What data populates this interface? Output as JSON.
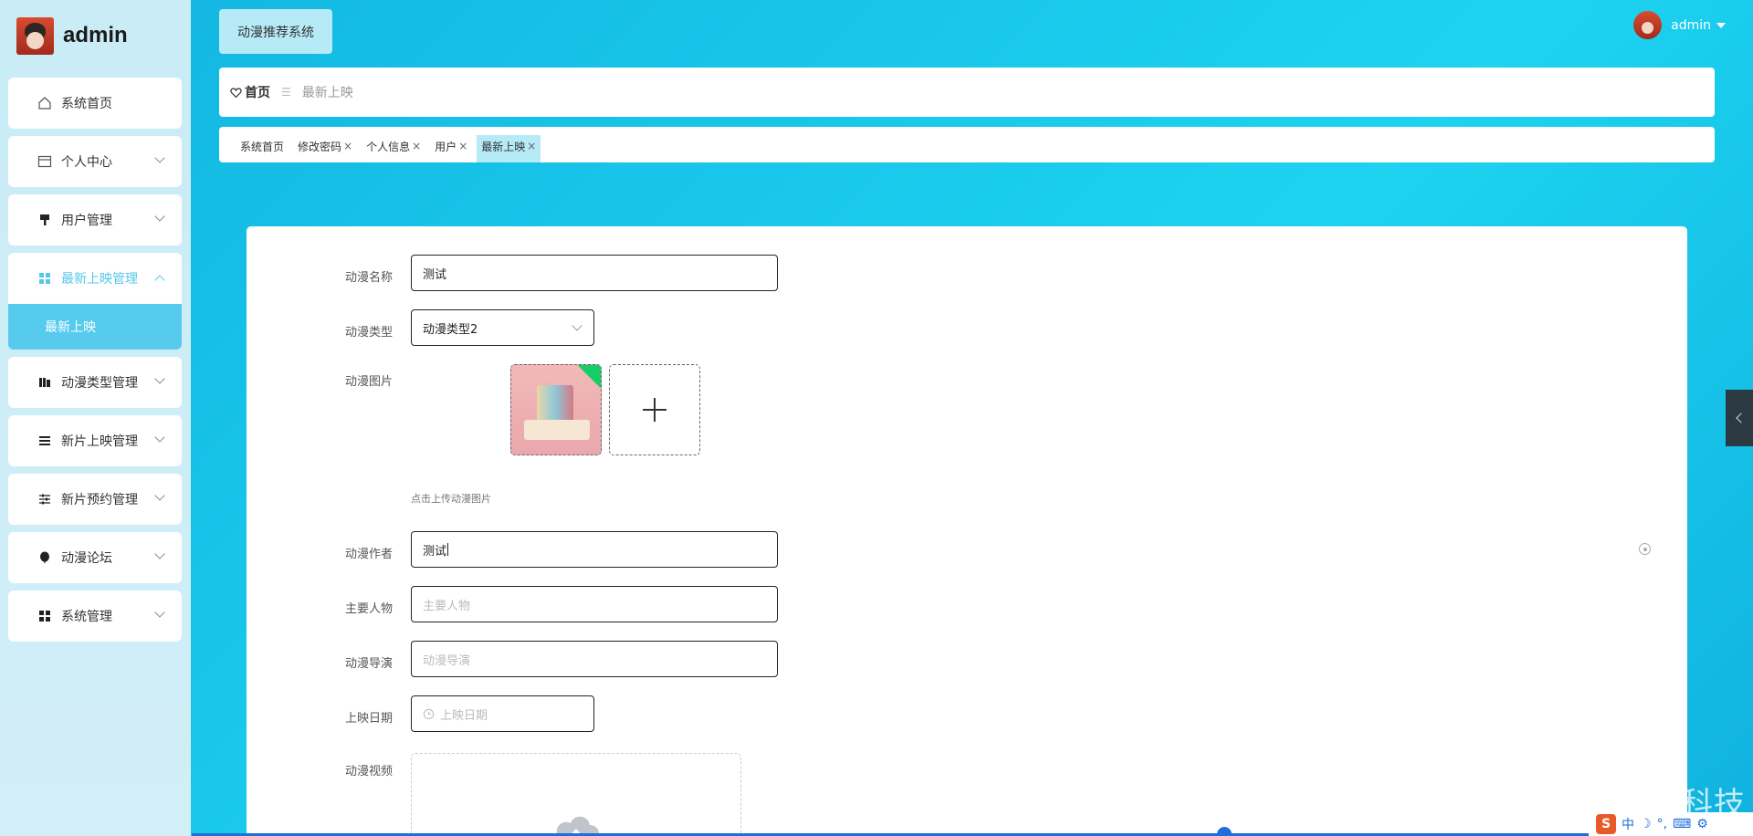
{
  "brand": {
    "name": "admin"
  },
  "sidebar": {
    "items": [
      {
        "label": "系统首页",
        "icon": "home-icon"
      },
      {
        "label": "个人中心",
        "icon": "card-icon"
      },
      {
        "label": "用户管理",
        "icon": "brush-icon"
      },
      {
        "label": "最新上映管理",
        "icon": "grid-icon",
        "active": true
      },
      {
        "label": "动漫类型管理",
        "icon": "bars-icon"
      },
      {
        "label": "新片上映管理",
        "icon": "list-icon"
      },
      {
        "label": "新片预约管理",
        "icon": "sliders-icon"
      },
      {
        "label": "动漫论坛",
        "icon": "balloon-icon"
      },
      {
        "label": "系统管理",
        "icon": "grid-icon"
      }
    ],
    "submenu": {
      "label": "最新上映"
    }
  },
  "header": {
    "system_name": "动漫推荐系统",
    "user": "admin"
  },
  "breadcrumb": {
    "home": "首页",
    "separator": "☰",
    "current": "最新上映"
  },
  "tabs": [
    {
      "label": "系统首页",
      "closable": false
    },
    {
      "label": "修改密码",
      "closable": true
    },
    {
      "label": "个人信息",
      "closable": true
    },
    {
      "label": "用户",
      "closable": true
    },
    {
      "label": "最新上映",
      "closable": true,
      "active": true
    }
  ],
  "tab_close": "×",
  "form": {
    "name": {
      "label": "动漫名称",
      "value": "测试"
    },
    "type": {
      "label": "动漫类型",
      "value": "动漫类型2"
    },
    "image": {
      "label": "动漫图片",
      "tip": "点击上传动漫图片"
    },
    "author": {
      "label": "动漫作者",
      "value": "测试"
    },
    "characters": {
      "label": "主要人物",
      "placeholder": "主要人物"
    },
    "director": {
      "label": "动漫导演",
      "placeholder": "动漫导演"
    },
    "release_date": {
      "label": "上映日期",
      "placeholder": "上映日期"
    },
    "video": {
      "label": "动漫视频"
    }
  },
  "watermark": "CSDN @辉时科技",
  "ime": {
    "lang": "中"
  },
  "colors": {
    "accent": "#56cbee",
    "bg_start": "#12b4e0",
    "bg_end": "#1dd3f0",
    "success_corner": "#13ce66"
  }
}
